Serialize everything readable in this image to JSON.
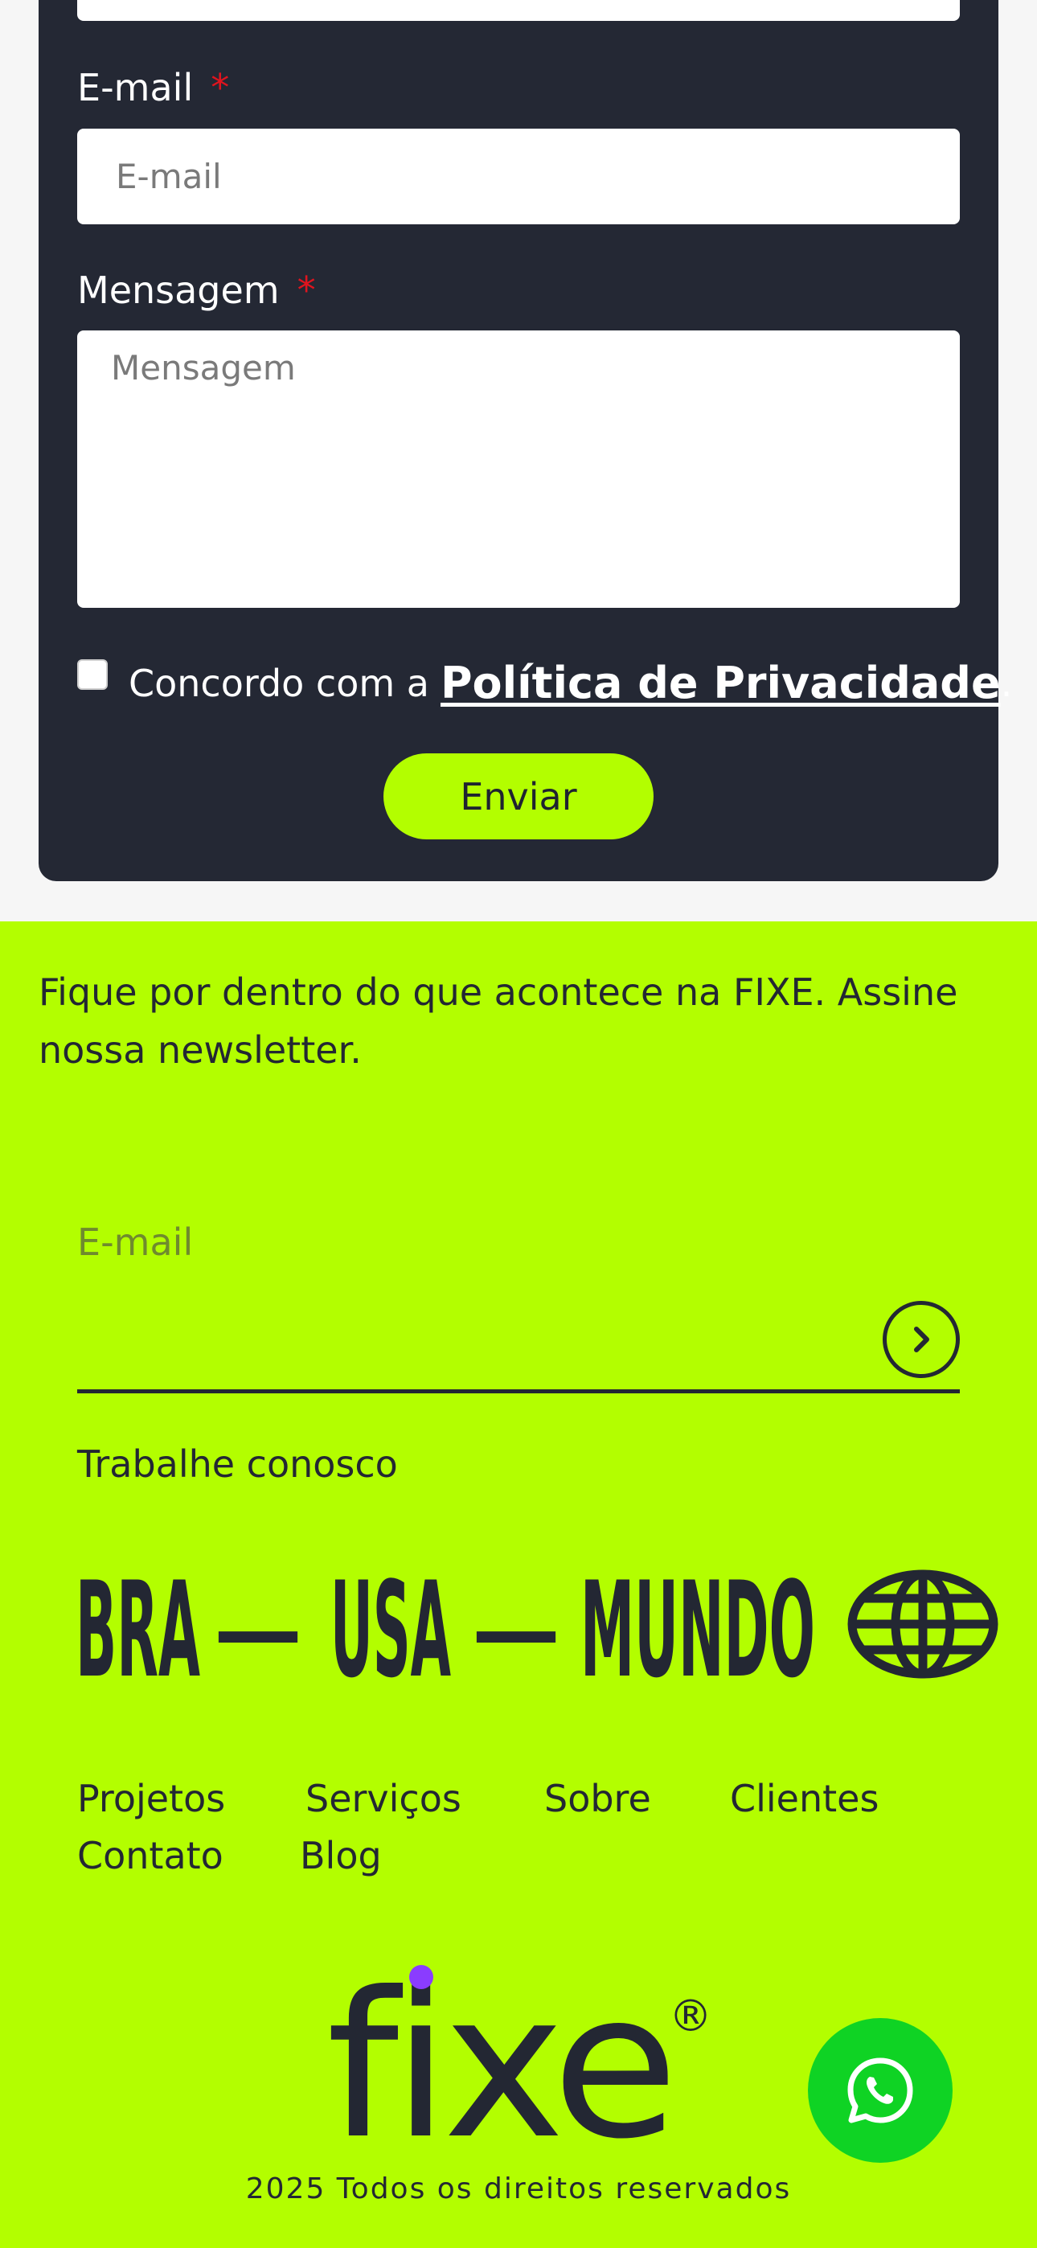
{
  "contact_form": {
    "email_label": "E-mail",
    "email_required": "*",
    "email_placeholder": "E-mail",
    "message_label": "Mensagem",
    "message_required": "*",
    "message_placeholder": "Mensagem",
    "consent_prefix": "Concordo com a",
    "policy_link": "Política de Privacidade",
    "consent_suffix": ".",
    "consent_checked": false,
    "submit_label": "Enviar"
  },
  "footer": {
    "newsletter_text": "Fique por dentro do que acontece na FIXE. Assine nossa newsletter.",
    "newsletter_placeholder": "E-mail",
    "work_with_us": "Trabalhe conosco",
    "locations_banner": {
      "bra": "BRA",
      "usa": "USA",
      "mundo": "MUNDO",
      "dash": "—"
    },
    "nav": [
      "Projetos",
      "Serviços",
      "Sobre",
      "Clientes",
      "Contato",
      "Blog"
    ],
    "logo_text": "fixe",
    "logo_mark": "®",
    "copyright": "2025 Todos os direitos reservados"
  },
  "icons": {
    "newsletter_submit": "chevron-right-icon",
    "globe": "globe-icon",
    "whatsapp": "whatsapp-icon"
  },
  "colors": {
    "accent_lime": "#b3fe00",
    "card_dark": "#242834",
    "text_dark": "#232733",
    "required_red": "#e0141e",
    "whatsapp_green": "#0fd324",
    "logo_dot_purple": "#8a3cff"
  }
}
